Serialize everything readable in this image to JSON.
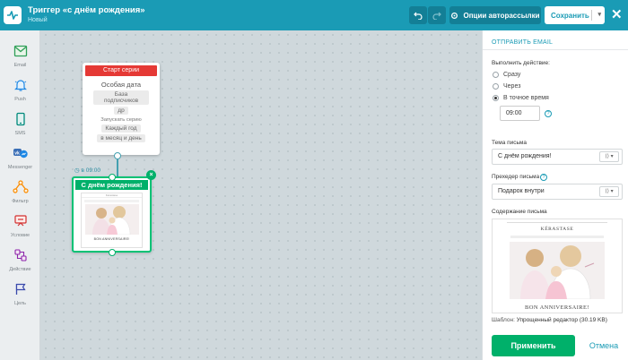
{
  "header": {
    "title": "Триггер «с днём рождения»",
    "status": "Новый",
    "undo_icon": "undo-icon",
    "redo_icon": "redo-icon",
    "options_label": "Опции авторассылки",
    "save_label": "Сохранить"
  },
  "palette": [
    {
      "label": "Email",
      "icon": "email-icon"
    },
    {
      "label": "Push",
      "icon": "bell-icon"
    },
    {
      "label": "SMS",
      "icon": "phone-icon"
    },
    {
      "label": "Messenger",
      "icon": "messenger-icon"
    },
    {
      "label": "Фильтр",
      "icon": "filter-icon"
    },
    {
      "label": "Условие",
      "icon": "condition-icon"
    },
    {
      "label": "Действие",
      "icon": "action-icon"
    },
    {
      "label": "Цель",
      "icon": "flag-icon"
    }
  ],
  "canvas": {
    "start_node": {
      "header": "Старт серии",
      "title": "Особая дата",
      "db_chip": "База подписчиков",
      "field_chip": "др",
      "run_label": "Запускать серию",
      "period_chip": "Каждый год",
      "day_chip": "в месяц и день"
    },
    "delay_label": "в 09:00",
    "email_node": {
      "header": "С днём рождения!",
      "thumb_caption": "BON ANNIVERSAIRE!"
    }
  },
  "panel": {
    "section_title": "ОТПРАВИТЬ EMAIL",
    "action_label": "Выполнить действие:",
    "options": [
      {
        "label": "Сразу",
        "selected": false
      },
      {
        "label": "Через",
        "selected": false
      },
      {
        "label": "В точное время",
        "selected": true
      }
    ],
    "time_value": "09:00",
    "subject_label": "Тема письма",
    "subject_value": "С днём рождения!",
    "preheader_label": "Прехедер письма",
    "preheader_value": "Подарок внутри",
    "content_label": "Содержание письма",
    "preview_logo": "KÉRASTASE",
    "preview_caption": "BON ANNIVERSAIRE!",
    "template_label": "Шаблон:",
    "template_value": "Упрощенный редактор (30.19 KB)",
    "apply_label": "Применить",
    "cancel_label": "Отмена"
  },
  "colors": {
    "header": "#1a9bb5",
    "start_header": "#e53935",
    "email_accent": "#00b06a"
  }
}
